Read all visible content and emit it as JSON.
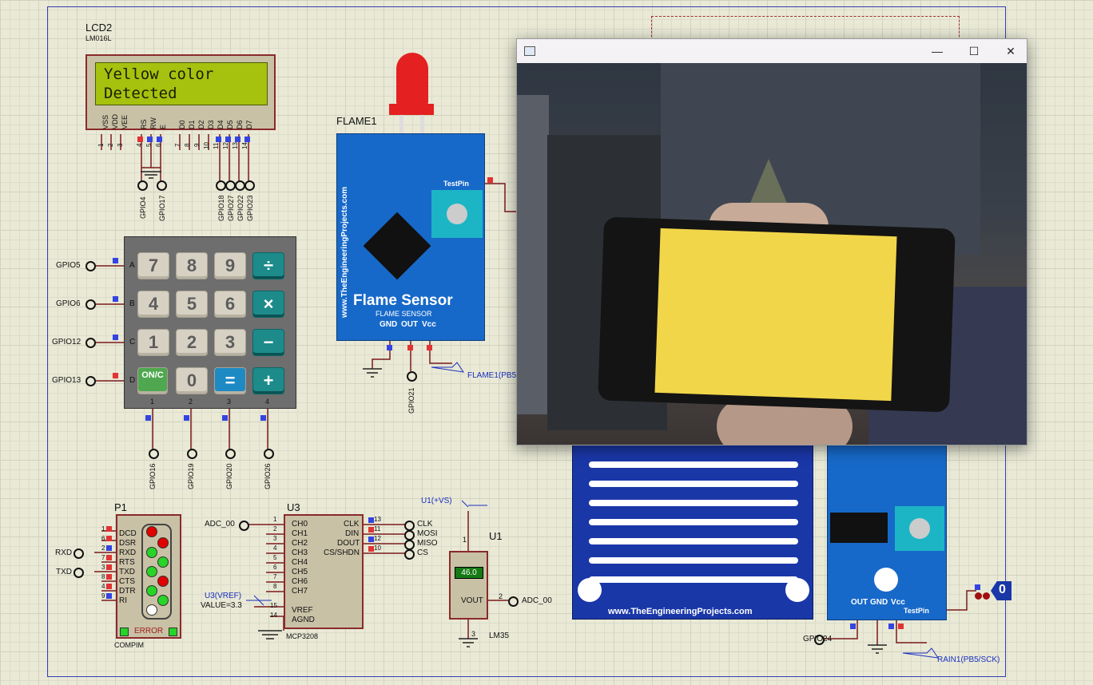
{
  "lcd": {
    "name": "LCD2",
    "model": "LM016L",
    "line1": "Yellow color",
    "line2": "Detected",
    "pins": [
      "VSS",
      "VDD",
      "VEE",
      "RS",
      "RW",
      "E",
      "D0",
      "D1",
      "D2",
      "D3",
      "D4",
      "D5",
      "D6",
      "D7"
    ],
    "pin_numbers": [
      "1",
      "2",
      "3",
      "4",
      "5",
      "6",
      "7",
      "8",
      "9",
      "10",
      "11",
      "12",
      "13",
      "14"
    ],
    "gpio": [
      "GPIO4",
      "GPIO17",
      "GPIO18",
      "GPIO27",
      "GPIO22",
      "GPIO23"
    ]
  },
  "keypad": {
    "rows": [
      [
        "7",
        "8",
        "9",
        "÷"
      ],
      [
        "4",
        "5",
        "6",
        "×"
      ],
      [
        "1",
        "2",
        "3",
        "−"
      ],
      [
        "ON/C",
        "0",
        "=",
        "+"
      ]
    ],
    "row_letters": [
      "A",
      "B",
      "C",
      "D"
    ],
    "col_numbers": [
      "1",
      "2",
      "3",
      "4"
    ],
    "row_gpio": [
      "GPIO5",
      "GPIO6",
      "GPIO12",
      "GPIO13"
    ],
    "col_gpio": [
      "GPIO16",
      "GPIO19",
      "GPIO20",
      "GPIO26"
    ]
  },
  "flame": {
    "name": "FLAME1",
    "website": "www.TheEngineeringProjects.com",
    "title": "Flame Sensor",
    "subtitle": "FLAME SENSOR",
    "pins": [
      "GND",
      "OUT",
      "Vcc"
    ],
    "testpin": "TestPin",
    "gpio": "GPIO21",
    "net": "FLAME1(PB5"
  },
  "comport": {
    "name": "P1",
    "model": "COMPIM",
    "pins": [
      "DCD",
      "DSR",
      "RXD",
      "RTS",
      "TXD",
      "CTS",
      "DTR",
      "RI"
    ],
    "pin_numbers": [
      "1",
      "6",
      "2",
      "7",
      "3",
      "8",
      "4",
      "9"
    ],
    "rxd": "RXD",
    "txd": "TXD",
    "error": "ERROR"
  },
  "adc": {
    "name": "U3",
    "model": "MCP3208",
    "left_pins": [
      "CH0",
      "CH1",
      "CH2",
      "CH3",
      "CH4",
      "CH5",
      "CH6",
      "CH7"
    ],
    "left_numbers": [
      "1",
      "2",
      "3",
      "4",
      "5",
      "6",
      "7",
      "8"
    ],
    "vref": "VREF",
    "agnd": "AGND",
    "vref_num": "15",
    "agnd_num": "14",
    "right_pins": [
      "CLK",
      "DIN",
      "DOUT",
      "CS/SHDN"
    ],
    "right_numbers": [
      "13",
      "11",
      "12",
      "10"
    ],
    "nets": [
      "CLK",
      "MOSI",
      "MISO",
      "CS"
    ],
    "adc_in": "ADC_00",
    "vref_label": "U3(VREF)",
    "vref_value": "VALUE=3.3"
  },
  "lm35": {
    "name": "U1",
    "model": "LM35",
    "reading": "46.0",
    "vout": "VOUT",
    "supply": "U1(+VS)",
    "out_net": "ADC_00",
    "pin1": "1",
    "pin2": "2",
    "pin3": "3"
  },
  "rain": {
    "website": "www.TheEngineeringProjects.com",
    "pins": [
      "OUT",
      "GND",
      "Vcc"
    ],
    "testpin": "TestPin",
    "gpio": "GPIO24",
    "net": "RAIN1(PB5/SCK)",
    "probe_value": "0"
  },
  "window": {
    "title_icon": "image-icon",
    "minimize": "—",
    "maximize": "☐",
    "close": "✕"
  },
  "colors": {
    "wire": "#7a1a1a",
    "board": "#1769c9",
    "yellow": "#f2d64a"
  }
}
